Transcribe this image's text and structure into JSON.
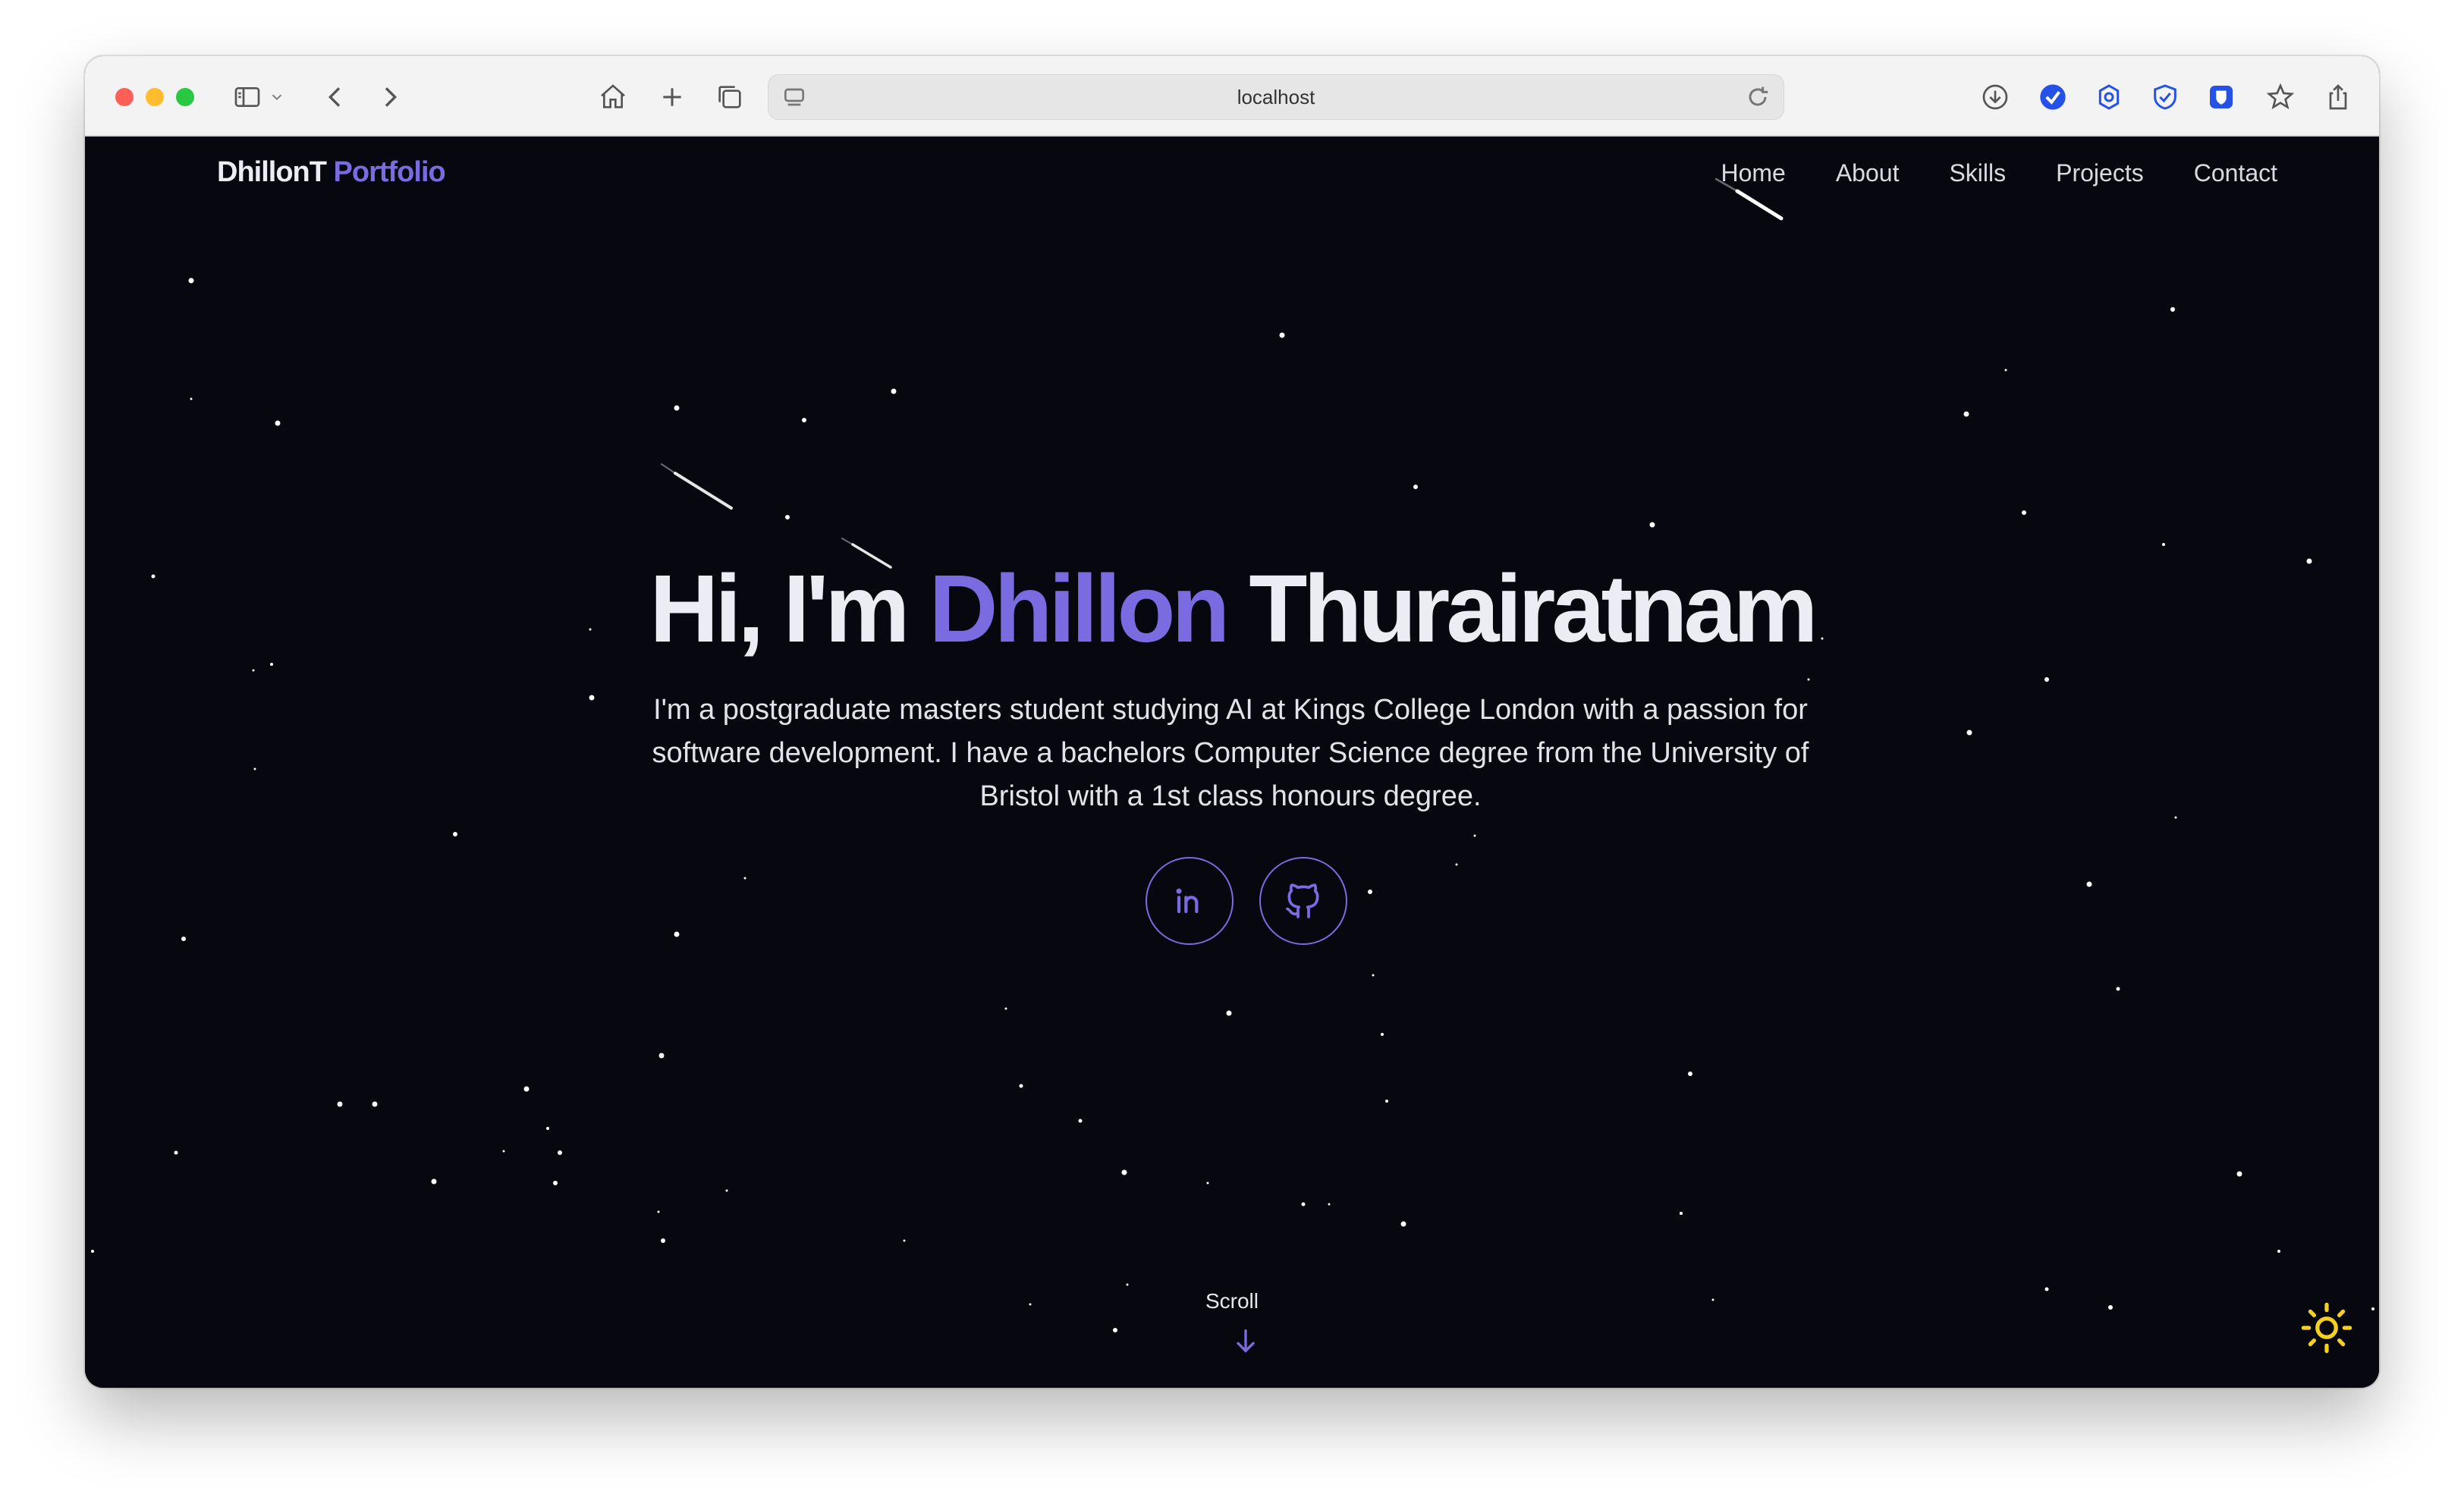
{
  "browser": {
    "url": "localhost",
    "icons": {
      "sidebar": "sidebar-icon",
      "back": "chevron-left-icon",
      "forward": "chevron-right-icon",
      "home": "home-icon",
      "new_tab": "plus-icon",
      "tabs": "tabs-overview-icon",
      "reload": "reload-icon",
      "downloads": "download-icon",
      "bookmark": "star-icon",
      "share": "share-icon"
    }
  },
  "nav": {
    "brand_main": "DhillonT",
    "brand_accent": "Portfolio",
    "links": [
      "Home",
      "About",
      "Skills",
      "Projects",
      "Contact"
    ]
  },
  "hero": {
    "greeting": "Hi, I'm",
    "first_name": "Dhillon",
    "last_name": "Thurairatnam",
    "description": "I'm a postgraduate masters student studying AI at Kings College London with a passion for software development. I have a bachelors Computer Science degree from the University of Bristol with a 1st class honours degree.",
    "socials": [
      {
        "name": "linkedin",
        "icon": "linkedin-icon"
      },
      {
        "name": "github",
        "icon": "github-icon"
      }
    ],
    "scroll_label": "Scroll"
  },
  "theme": {
    "toggle_icon": "sun-icon",
    "accent": "#7b6be0",
    "background": "#07080f",
    "sun_color": "#f5d020"
  }
}
